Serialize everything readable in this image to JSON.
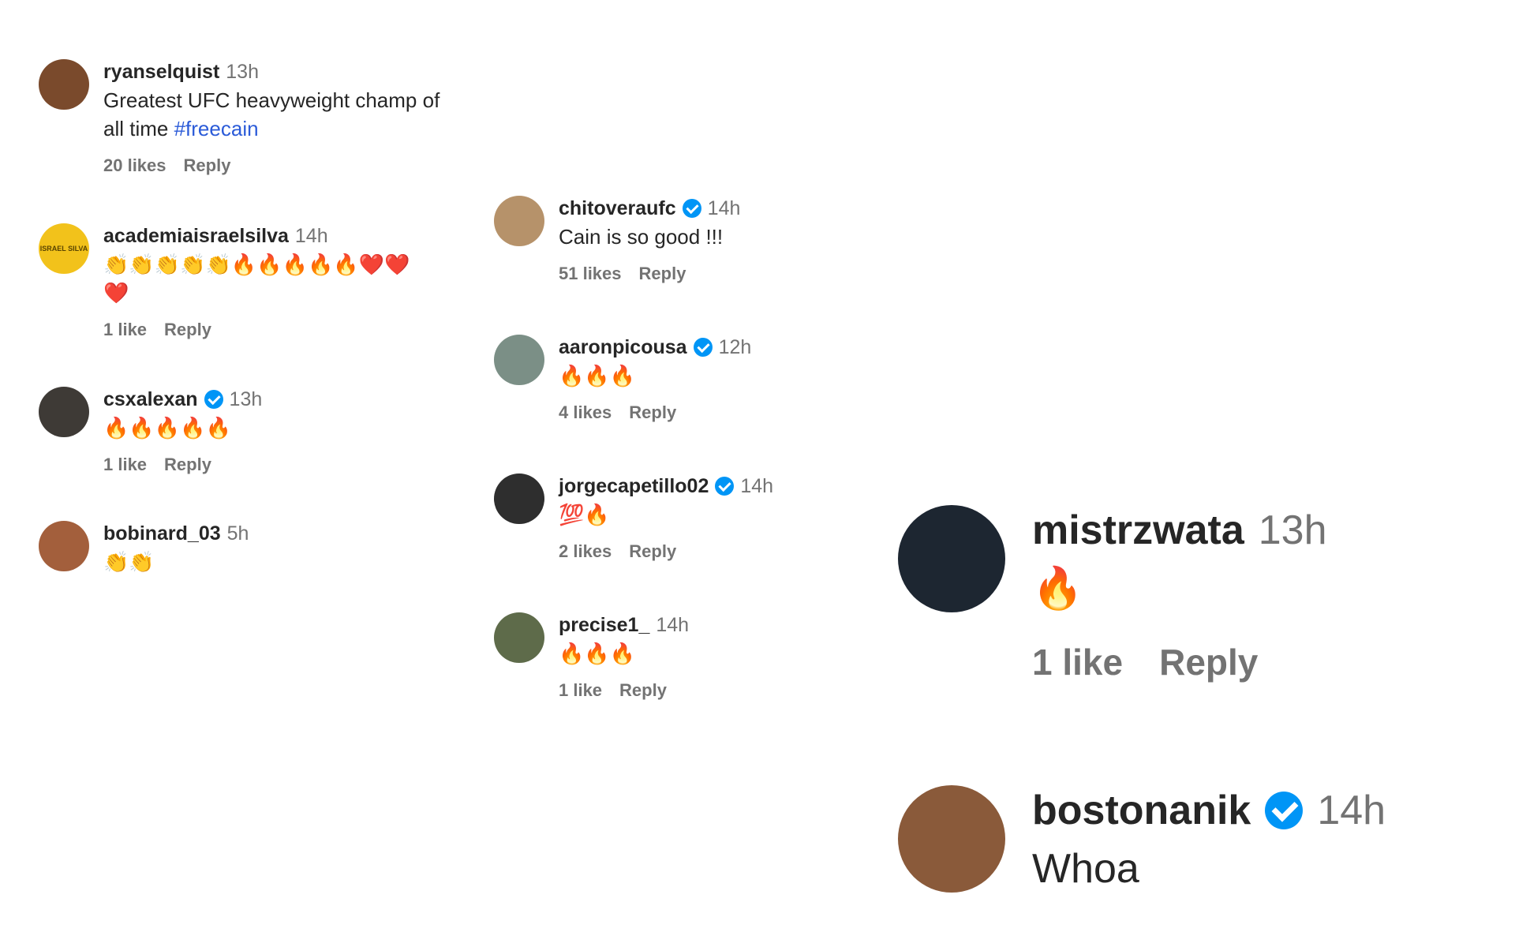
{
  "comments": {
    "c1": {
      "user": "ryanselquist",
      "time": "13h",
      "text": "Greatest UFC heavyweight champ of all time",
      "hashtag": "#freecain",
      "likes": "20 likes",
      "reply": "Reply",
      "avatar_color": "#7a4a2c"
    },
    "c2": {
      "user": "academiaisraelsilva",
      "time": "14h",
      "text": "👏👏👏👏👏🔥🔥🔥🔥🔥❤️❤️❤️",
      "likes": "1 like",
      "reply": "Reply",
      "avatar_text": "ISRAEL SILVA",
      "avatar_color": "#f2c21b"
    },
    "c3": {
      "user": "csxalexan",
      "time": "13h",
      "text": "🔥🔥🔥🔥🔥",
      "likes": "1 like",
      "reply": "Reply",
      "avatar_color": "#3e3a36"
    },
    "c4": {
      "user": "bobinard_03",
      "time": "5h",
      "text": "👏👏",
      "avatar_color": "#a35f3c"
    },
    "c5": {
      "user": "chitoveraufc",
      "time": "14h",
      "text": "Cain is so good !!!",
      "likes": "51 likes",
      "reply": "Reply",
      "avatar_color": "#b6926a"
    },
    "c6": {
      "user": "aaronpicousa",
      "time": "12h",
      "text": "🔥🔥🔥",
      "likes": "4 likes",
      "reply": "Reply",
      "avatar_color": "#7b8f86"
    },
    "c7": {
      "user": "jorgecapetillo02",
      "time": "14h",
      "text": "💯🔥",
      "likes": "2 likes",
      "reply": "Reply",
      "avatar_color": "#2e2e2e"
    },
    "c8": {
      "user": "precise1_",
      "time": "14h",
      "text": "🔥🔥🔥",
      "likes": "1 like",
      "reply": "Reply",
      "avatar_color": "#5e6b4a"
    },
    "c9": {
      "user": "mistrzwata",
      "time": "13h",
      "text": "🔥",
      "likes": "1 like",
      "reply": "Reply",
      "avatar_color": "#1d2631"
    },
    "c10": {
      "user": "bostonanik",
      "time": "14h",
      "text": "Whoa",
      "avatar_color": "#8a5a3a"
    }
  }
}
